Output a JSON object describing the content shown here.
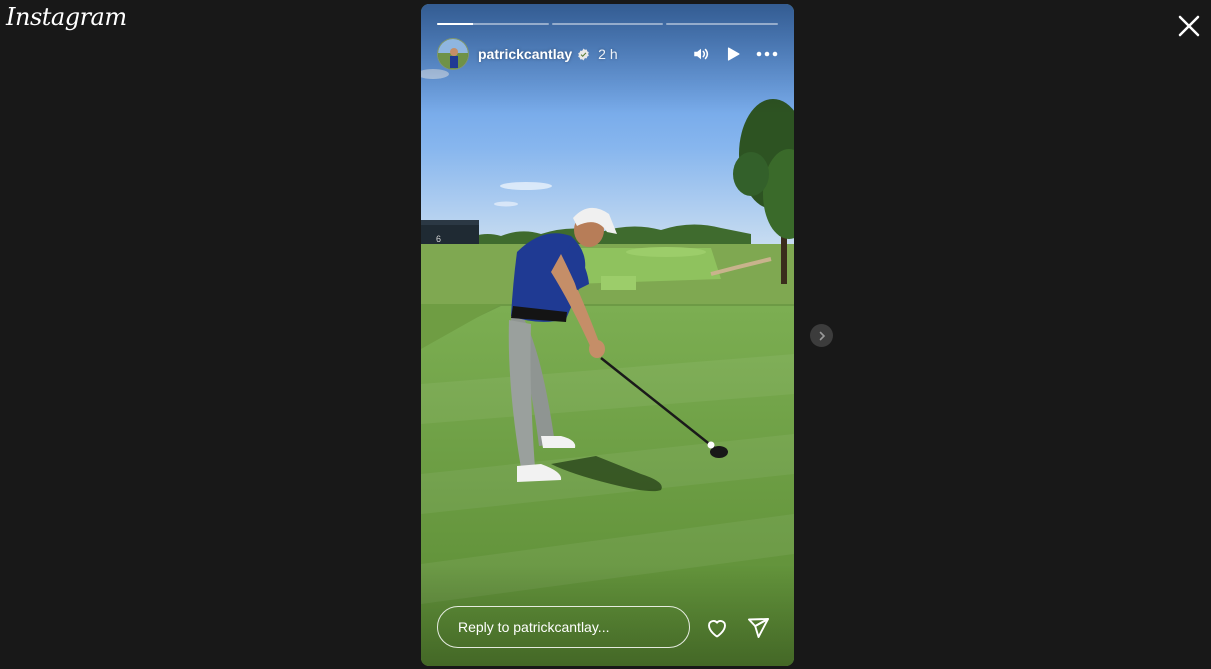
{
  "app": {
    "logo_text": "Instagram"
  },
  "story": {
    "username": "patrickcantlay",
    "time_ago": "2 h",
    "segments": [
      {
        "progress": 0.32
      },
      {
        "progress": 0
      },
      {
        "progress": 0
      }
    ],
    "reply_placeholder": "Reply to patrickcantlay...",
    "sign_number": "6"
  },
  "icons": {
    "close": "close-icon",
    "verified": "verified-badge-icon",
    "sound": "volume-icon",
    "play": "play-icon",
    "more": "more-options-icon",
    "like": "heart-icon",
    "share": "send-icon",
    "next": "chevron-right-icon"
  }
}
